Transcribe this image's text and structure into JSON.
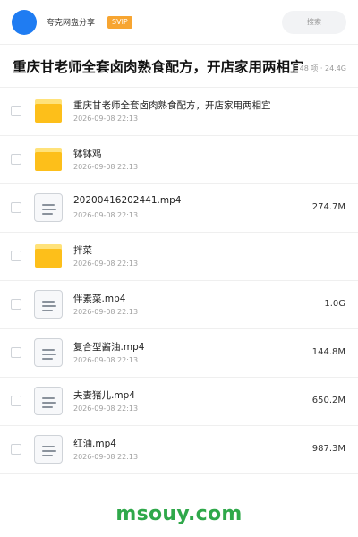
{
  "header": {
    "brand": "夸克网盘分享",
    "badge": "SVIP",
    "search_label": "搜索"
  },
  "share": {
    "title": "重庆甘老师全套卤肉熟食配方，开店家用两相宜",
    "meta": "48 项 · 24.4G"
  },
  "files": [
    {
      "name": "重庆甘老师全套卤肉熟食配方，开店家用两相宜",
      "date": "2026-09-08 22:13",
      "size": "",
      "type": "folder-icon"
    },
    {
      "name": "钵钵鸡",
      "date": "2026-09-08 22:13",
      "size": "",
      "type": "folder-icon"
    },
    {
      "name": "20200416202441.mp4",
      "date": "2026-09-08 22:13",
      "size": "274.7M",
      "type": "file-icon"
    },
    {
      "name": "拌菜",
      "date": "2026-09-08 22:13",
      "size": "",
      "type": "folder-icon"
    },
    {
      "name": "伴素菜.mp4",
      "date": "2026-09-08 22:13",
      "size": "1.0G",
      "type": "file-icon"
    },
    {
      "name": "复合型酱油.mp4",
      "date": "2026-09-08 22:13",
      "size": "144.8M",
      "type": "file-icon"
    },
    {
      "name": "夫妻猪儿.mp4",
      "date": "2026-09-08 22:13",
      "size": "650.2M",
      "type": "file-icon"
    },
    {
      "name": "红油.mp4",
      "date": "2026-09-08 22:13",
      "size": "987.3M",
      "type": "file-icon"
    }
  ],
  "watermark": "msouy.com",
  "colors": {
    "accent": "#1f7cf2",
    "svip": "#f7a531",
    "folder": "#fdbf1a",
    "watermark": "#2fa84a"
  }
}
